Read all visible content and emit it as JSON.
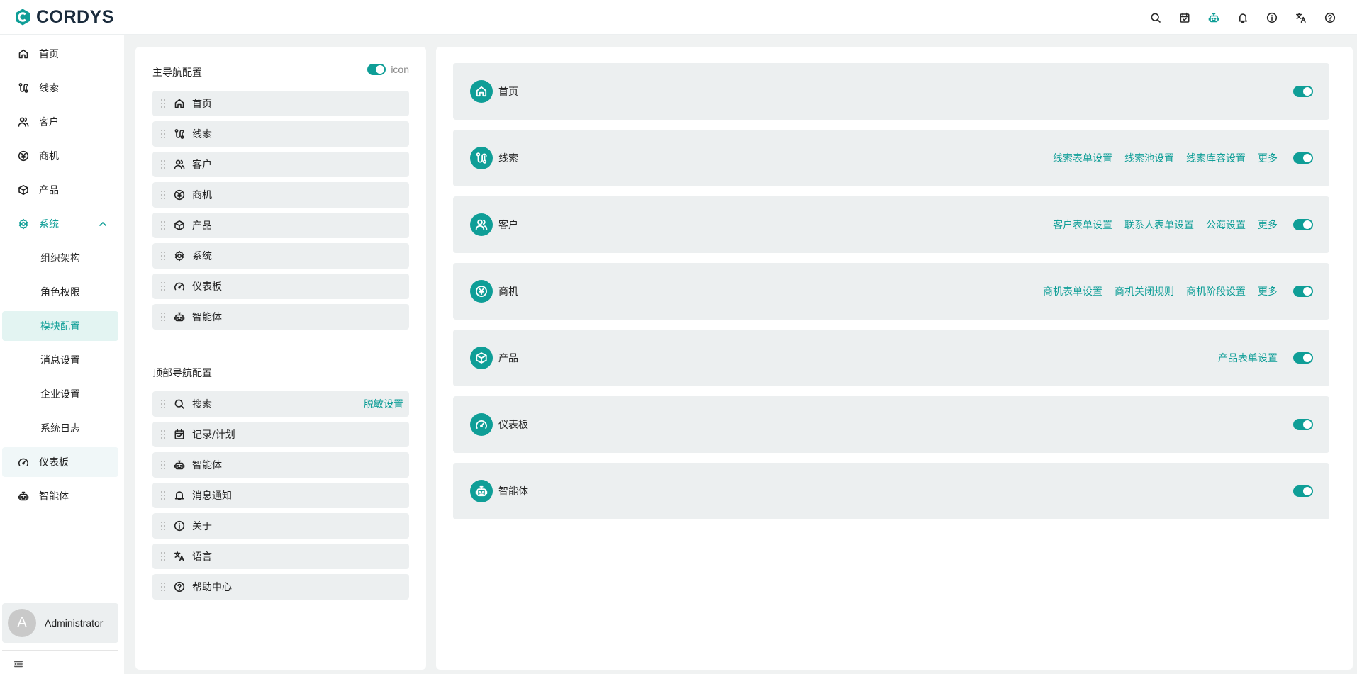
{
  "brand": {
    "name": "CORDYS",
    "color": "#0f9e97"
  },
  "top_icons": [
    "search-icon",
    "calendar-icon",
    "robot-icon",
    "bell-icon",
    "info-icon",
    "language-icon",
    "help-icon"
  ],
  "sidebar": {
    "items": [
      {
        "label": "首页"
      },
      {
        "label": "线索"
      },
      {
        "label": "客户"
      },
      {
        "label": "商机"
      },
      {
        "label": "产品"
      },
      {
        "label": "系统"
      },
      {
        "label": "组织架构"
      },
      {
        "label": "角色权限"
      },
      {
        "label": "模块配置"
      },
      {
        "label": "消息设置"
      },
      {
        "label": "企业设置"
      },
      {
        "label": "系统日志"
      },
      {
        "label": "仪表板"
      },
      {
        "label": "智能体"
      }
    ],
    "user": {
      "initial": "A",
      "name": "Administrator"
    }
  },
  "config": {
    "main_nav_title": "主导航配置",
    "icon_toggle_label": "icon",
    "main_nav": [
      {
        "label": "首页"
      },
      {
        "label": "线索"
      },
      {
        "label": "客户"
      },
      {
        "label": "商机"
      },
      {
        "label": "产品"
      },
      {
        "label": "系统"
      },
      {
        "label": "仪表板"
      },
      {
        "label": "智能体"
      }
    ],
    "top_nav_title": "顶部导航配置",
    "top_nav": [
      {
        "label": "搜索",
        "link": "脱敏设置"
      },
      {
        "label": "记录/计划"
      },
      {
        "label": "智能体"
      },
      {
        "label": "消息通知"
      },
      {
        "label": "关于"
      },
      {
        "label": "语言"
      },
      {
        "label": "帮助中心"
      }
    ]
  },
  "modules": [
    {
      "label": "首页",
      "links": [],
      "enabled": true
    },
    {
      "label": "线索",
      "links": [
        "线索表单设置",
        "线索池设置",
        "线索库容设置",
        "更多"
      ],
      "enabled": true
    },
    {
      "label": "客户",
      "links": [
        "客户表单设置",
        "联系人表单设置",
        "公海设置",
        "更多"
      ],
      "enabled": true
    },
    {
      "label": "商机",
      "links": [
        "商机表单设置",
        "商机关闭规则",
        "商机阶段设置",
        "更多"
      ],
      "enabled": true
    },
    {
      "label": "产品",
      "links": [
        "产品表单设置"
      ],
      "enabled": true
    },
    {
      "label": "仪表板",
      "links": [],
      "enabled": true
    },
    {
      "label": "智能体",
      "links": [],
      "enabled": true
    }
  ]
}
